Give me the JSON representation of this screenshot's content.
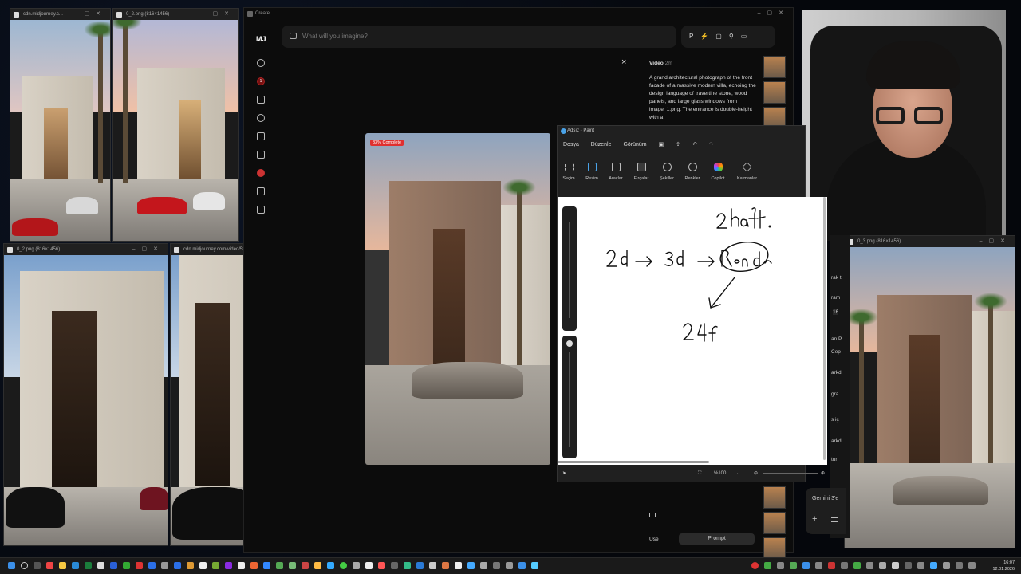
{
  "windows": {
    "img_top_left": {
      "title": "cdn.midjourney.c..."
    },
    "img_top_second": {
      "title": "0_2.png (816×1456)"
    },
    "img_bottom_left": {
      "title": "0_2.png (816×1456)"
    },
    "img_bottom_second": {
      "title": "cdn.midjourney.com/video/5882c93e-a03f-4b10-9..."
    },
    "img_right": {
      "title": "0_3.png (816×1456)"
    }
  },
  "midjourney": {
    "title": "Create",
    "logo": "MJ",
    "badge": "1",
    "search_placeholder": "What will you imagine?",
    "tool_p": "P",
    "progress": "33% Complete",
    "close": "×",
    "panel": {
      "title": "Video",
      "time": "2m",
      "prompt": "A grand architectural photograph of the front facade of a massive modern villa, echoing the design language of travertine stone, wood panels, and large glass windows from image_1.png. The entrance is double-height with a",
      "use_label": "Use",
      "prompt_button": "Prompt"
    }
  },
  "paint": {
    "title": "Adsız - Paint",
    "menu": [
      "Dosya",
      "Düzenle",
      "Görünüm"
    ],
    "ribbon": [
      "Seçim",
      "Resim",
      "Araçlar",
      "Fırçalar",
      "Şekiller",
      "Renkler",
      "Copilot",
      "Katmanlar"
    ],
    "zoom": "%100"
  },
  "right_browser": {
    "fragments": [
      "rak t",
      "ram",
      "16",
      "an P",
      "Cep",
      "arkd",
      "gra",
      "s iç",
      "arkd",
      "tur"
    ],
    "gemini": "Gemini 3'e",
    "plus": "+"
  },
  "taskbar": {
    "time": "16:07",
    "date": "12.01.2026"
  },
  "colors": {
    "progress_red": "#e0302f",
    "accent": "#2b6fe8"
  }
}
